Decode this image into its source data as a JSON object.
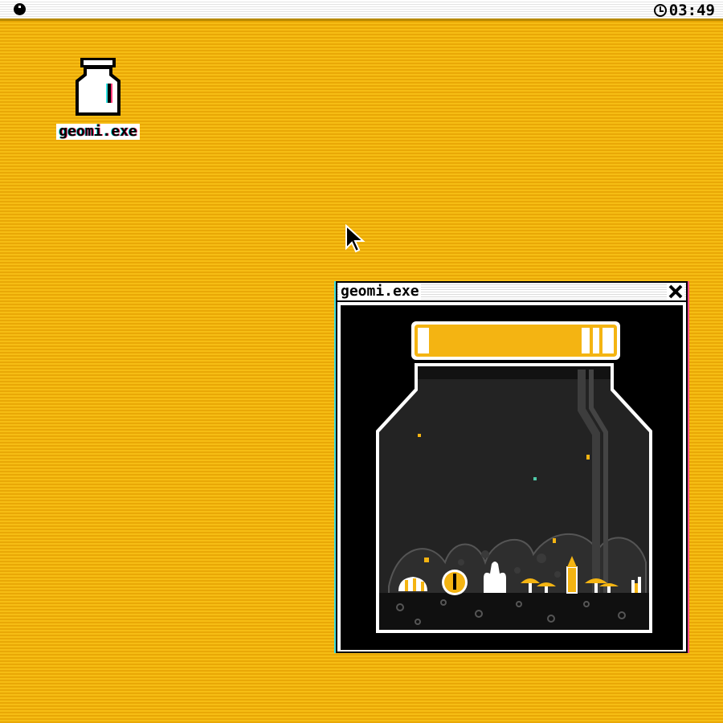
{
  "menubar": {
    "apple_icon": "round-menu-icon",
    "clock_icon": "clock-icon",
    "time": "03:49"
  },
  "desktop": {
    "icon": {
      "name": "jar-icon",
      "label": "geomi.exe"
    }
  },
  "window": {
    "title": "geomi.exe",
    "close_icon": "close-icon",
    "scene": "jar-terrarium"
  },
  "colors": {
    "desktop": "#f2b50c",
    "accent": "#f4b412",
    "jar_interior": "#222222",
    "window_bg": "#000000"
  }
}
